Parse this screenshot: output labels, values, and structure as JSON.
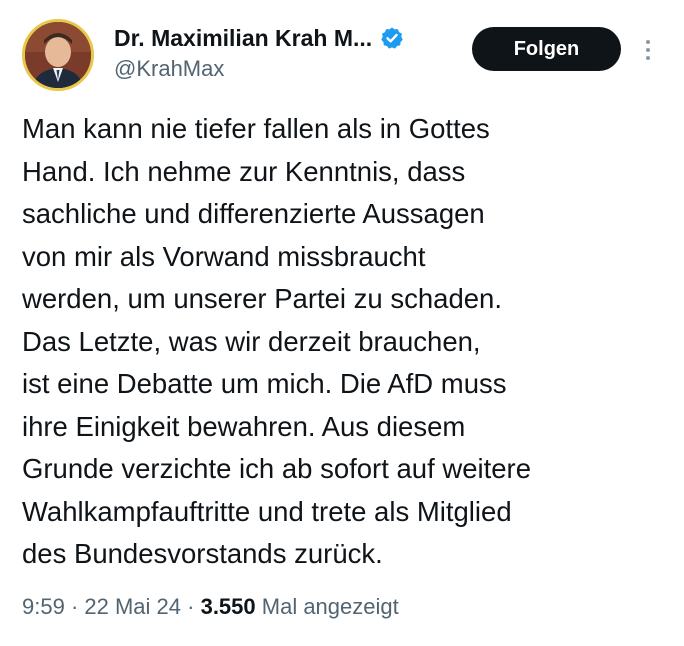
{
  "author": {
    "display_name": "Dr. Maximilian Krah M...",
    "handle": "@KrahMax",
    "verified": true,
    "verified_color": "#1d9bf0"
  },
  "actions": {
    "follow_label": "Folgen",
    "more_icon": "vertical-ellipsis-icon"
  },
  "tweet": {
    "lines": [
      "Man kann nie tiefer fallen als in Gottes",
      "Hand. Ich nehme zur Kenntnis, dass",
      "sachliche und differenzierte Aussagen",
      "von mir als Vorwand missbraucht",
      "werden, um unserer Partei zu schaden.",
      "Das Letzte, was wir derzeit brauchen,",
      "ist eine Debatte um mich. Die AfD muss",
      "ihre Einigkeit bewahren. Aus diesem",
      "Grunde verzichte ich ab sofort auf weitere",
      "Wahlkampfauftritte und trete als Mitglied",
      "des Bundesvorstands zurück."
    ]
  },
  "meta": {
    "time": "9:59",
    "separator": " · ",
    "date": "22 Mai 24",
    "views_count": "3.550",
    "views_label": " Mal angezeigt"
  }
}
